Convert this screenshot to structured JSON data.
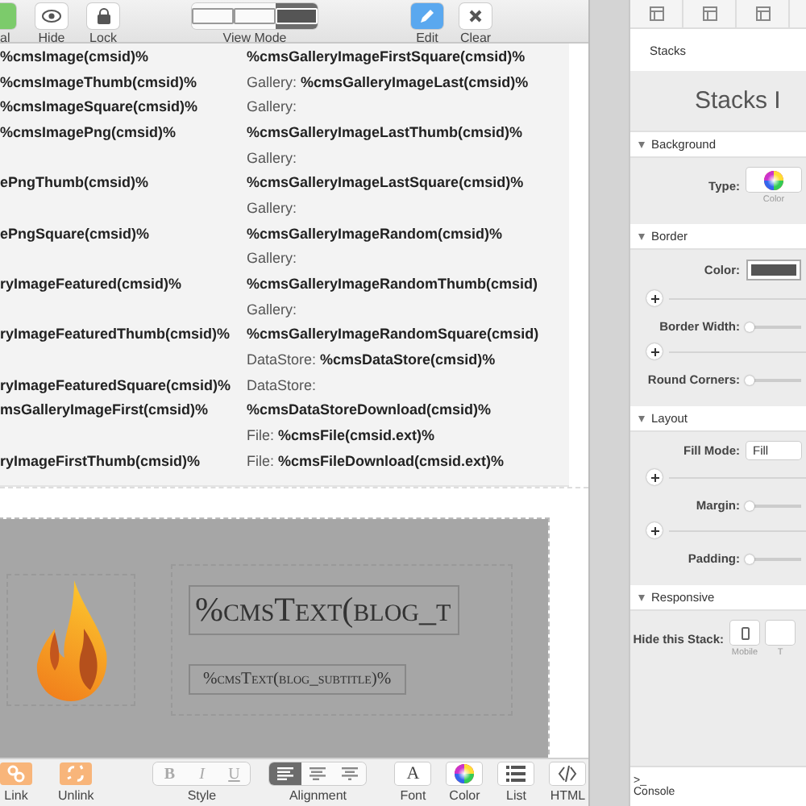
{
  "toolbar": {
    "left_buttons": [
      {
        "label": "al",
        "kind": "green"
      },
      {
        "label": "Hide",
        "kind": "eye"
      },
      {
        "label": "Lock",
        "kind": "lock"
      }
    ],
    "view_mode": {
      "label": "View Mode",
      "options": [
        {
          "selected": false
        },
        {
          "selected": false
        },
        {
          "selected": true
        }
      ]
    },
    "right_buttons": [
      {
        "label": "Edit",
        "kind": "pencil"
      },
      {
        "label": "Clear",
        "kind": "cross"
      }
    ]
  },
  "tags_list": {
    "rows": [
      {
        "left": "%cmsImage(cmsid)%",
        "right": "%cmsGalleryImageFirstSquare(cmsid)%"
      },
      {
        "left": "%cmsImageThumb(cmsid)%",
        "right": "Gallery: **%cmsGalleryImageLast(cmsid)%**"
      },
      {
        "left": "%cmsImageSquare(cmsid)%",
        "right": "Gallery:"
      },
      {
        "left": "%cmsImagePng(cmsid)%",
        "right": "**%cmsGalleryImageLastThumb(cmsid)%**"
      },
      {
        "left": "",
        "right": "Gallery:"
      },
      {
        "left": "ePngThumb(cmsid)%",
        "right": "**%cmsGalleryImageLastSquare(cmsid)%**"
      },
      {
        "left": "",
        "right": "Gallery:"
      },
      {
        "left": "ePngSquare(cmsid)%",
        "right": "**%cmsGalleryImageRandom(cmsid)%**"
      },
      {
        "left": "",
        "right": "Gallery:"
      },
      {
        "left": "ryImageFeatured(cmsid)%",
        "right": "**%cmsGalleryImageRandomThumb(cmsid)**"
      },
      {
        "left": "",
        "right": "Gallery:"
      },
      {
        "left": "ryImageFeaturedThumb(cmsid)%",
        "right": "**%cmsGalleryImageRandomSquare(cmsid)**"
      },
      {
        "left": "",
        "right": "DataStore: **%cmsDataStore(cmsid)%**"
      },
      {
        "left": "ryImageFeaturedSquare(cmsid)%",
        "right": "DataStore:"
      },
      {
        "left": "msGalleryImageFirst(cmsid)%",
        "right": "**%cmsDataStoreDownload(cmsid)%**"
      },
      {
        "left": "",
        "right": "File: **%cmsFile(cmsid.ext)%**"
      },
      {
        "left": "ryImageFirstThumb(cmsid)%",
        "right": "File: **%cmsFileDownload(cmsid.ext)%**"
      }
    ]
  },
  "header_banner": {
    "title": "%cmsText(blog_t",
    "subtitle": "%cmsText(blog_subtitle)%"
  },
  "format_bar": {
    "link_buttons": [
      {
        "label": "Link",
        "kind": "link"
      },
      {
        "label": "Unlink",
        "kind": "unlink"
      }
    ],
    "style": {
      "label": "Style",
      "options": [
        {
          "glyph": "B"
        },
        {
          "glyph": "I"
        },
        {
          "glyph": "U"
        }
      ]
    },
    "alignment": {
      "label": "Alignment",
      "options": [
        {
          "selected": true
        },
        {
          "selected": false
        },
        {
          "selected": false
        }
      ]
    },
    "tools": [
      {
        "label": "Font",
        "kind": "font",
        "glyph": "A"
      },
      {
        "label": "Color",
        "kind": "color"
      },
      {
        "label": "List",
        "kind": "list"
      },
      {
        "label": "HTML",
        "kind": "html"
      }
    ]
  },
  "inspector": {
    "header": "Stacks",
    "title": "Stacks I",
    "sections": [
      {
        "title": "Background",
        "expanded": true,
        "rows": [
          {
            "kind": "type",
            "label": "Type:",
            "caption": "Color"
          }
        ]
      },
      {
        "title": "Border",
        "expanded": true,
        "rows": [
          {
            "kind": "color",
            "label": "Color:"
          },
          {
            "kind": "slider",
            "label": "Border Width:",
            "level": 0
          },
          {
            "kind": "slider",
            "label": "Round Corners:",
            "level": 0
          }
        ]
      },
      {
        "title": "Layout",
        "expanded": true,
        "rows": [
          {
            "kind": "select",
            "label": "Fill Mode:",
            "value": "Fill"
          },
          {
            "kind": "slider",
            "label": "Margin:",
            "level": 0
          },
          {
            "kind": "slider",
            "label": "Padding:",
            "level": 0
          }
        ]
      },
      {
        "title": "Responsive",
        "expanded": true,
        "rows": [
          {
            "kind": "devices",
            "label": "Hide this Stack:",
            "devices": [
              "Mobile",
              "T"
            ]
          }
        ]
      }
    ]
  },
  "console": {
    "prompt": ">_",
    "label": "Console"
  }
}
